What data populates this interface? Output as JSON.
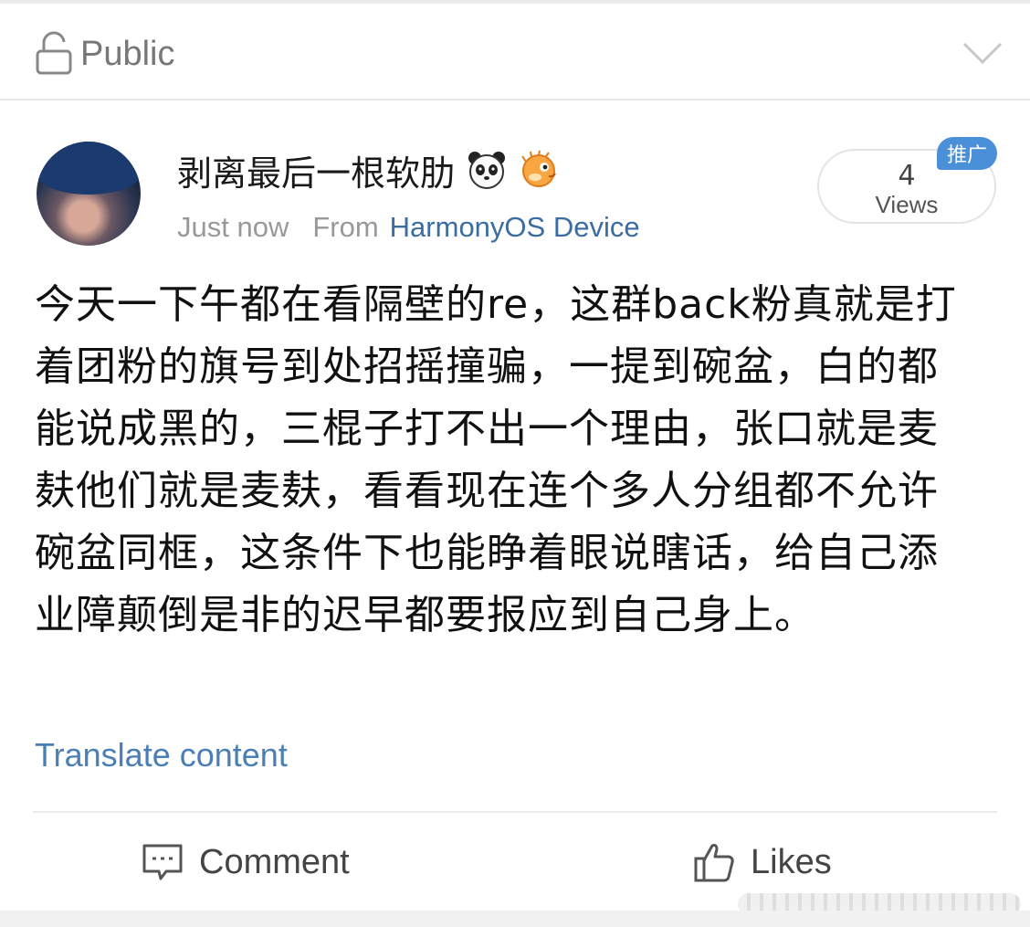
{
  "header": {
    "visibility_label": "Public"
  },
  "post": {
    "username": "剥离最后一根软肋",
    "timestamp": "Just now",
    "from_label": "From",
    "source": "HarmonyOS Device",
    "views_count": "4",
    "views_label": "Views",
    "promo_badge": "推广",
    "text": "今天一下午都在看隔壁的re，这群back粉真就是打着团粉的旗号到处招摇撞骗，一提到碗盆，白的都能说成黑的，三棍子打不出一个理由，张口就是麦麸他们就是麦麸，看看现在连个多人分组都不允许碗盆同框，这条件下也能睁着眼说瞎话，给自己添业障颠倒是非的迟早都要报应到自己身上。",
    "translate_label": "Translate content"
  },
  "actions": {
    "comment_label": "Comment",
    "likes_label": "Likes"
  },
  "icons": {
    "visibility": "lock-icon",
    "expand": "chevron-down-icon",
    "badge_1": "panda-icon",
    "badge_2": "pufferfish-icon",
    "comment": "comment-icon",
    "likes": "thumbs-up-icon"
  },
  "colors": {
    "link": "#3a6da3",
    "translate": "#4a7fb5",
    "badge": "#4a90d9",
    "muted_text": "#999999"
  }
}
